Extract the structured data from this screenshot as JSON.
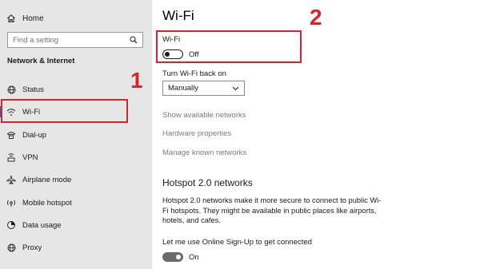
{
  "sidebar": {
    "home_label": "Home",
    "search_placeholder": "Find a setting",
    "section_title": "Network & Internet",
    "items": [
      {
        "label": "Status",
        "icon": "globe-icon"
      },
      {
        "label": "Wi-Fi",
        "icon": "wifi-icon"
      },
      {
        "label": "Dial-up",
        "icon": "dialup-icon"
      },
      {
        "label": "VPN",
        "icon": "vpn-icon"
      },
      {
        "label": "Airplane mode",
        "icon": "airplane-icon"
      },
      {
        "label": "Mobile hotspot",
        "icon": "hotspot-icon"
      },
      {
        "label": "Data usage",
        "icon": "data-usage-icon"
      },
      {
        "label": "Proxy",
        "icon": "globe-icon"
      }
    ]
  },
  "main": {
    "title": "Wi-Fi",
    "wifi_toggle": {
      "label": "Wi-Fi",
      "state": "Off"
    },
    "turn_back_on": {
      "label": "Turn Wi-Fi back on",
      "selected": "Manually"
    },
    "links": [
      "Show available networks",
      "Hardware properties",
      "Manage known networks"
    ],
    "hotspot": {
      "heading": "Hotspot 2.0 networks",
      "description": "Hotspot 2.0 networks make it more secure to connect to public Wi-Fi hotspots. They might be available in public places like airports, hotels, and cafes.",
      "online_signup_label": "Let me use Online Sign-Up to get connected",
      "online_signup_state": "On"
    }
  },
  "annotations": {
    "one": "1",
    "two": "2"
  },
  "colors": {
    "accent": "#0078d7",
    "annotation": "#d9222a",
    "sidebar_bg": "#e6e6e6"
  }
}
